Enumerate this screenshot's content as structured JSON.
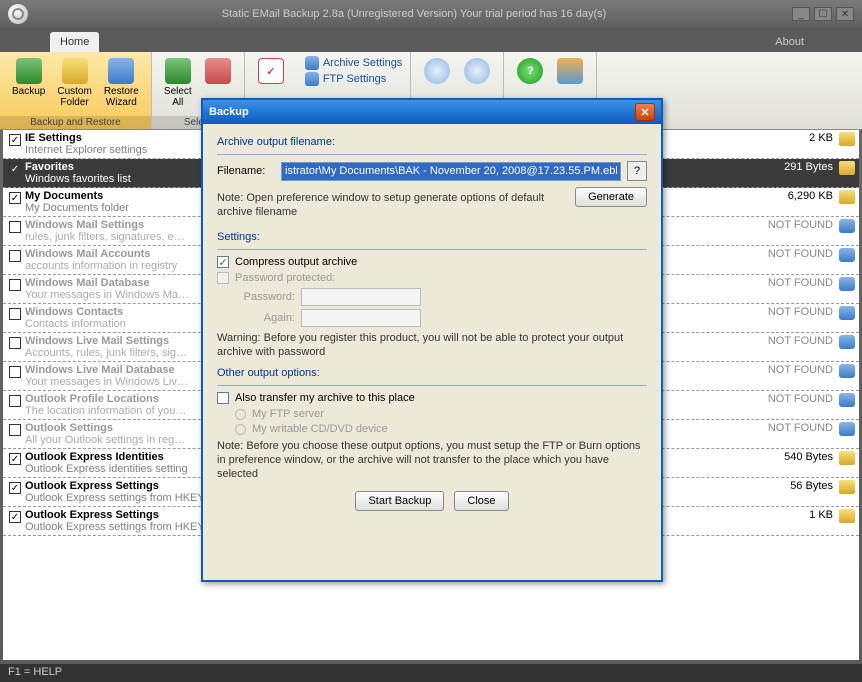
{
  "title": "Static EMail Backup 2.8a (Unregistered Version) Your trial period has 16 day(s)",
  "tabs": {
    "home": "Home",
    "about": "About"
  },
  "ribbon": {
    "backup": "Backup",
    "custom": "Custom\nFolder",
    "restore": "Restore\nWizard",
    "group1": "Backup and Restore",
    "selectall": "Select\nAll",
    "group2": "Select",
    "archive": "Archive Settings",
    "ftp": "FTP Settings"
  },
  "items": [
    {
      "checked": true,
      "title": "IE Settings",
      "desc": "Internet Explorer settings",
      "size": "2 KB",
      "found": true
    },
    {
      "checked": true,
      "title": "Favorites",
      "desc": "Windows favorites list",
      "size": "291 Bytes",
      "found": true,
      "sel": true
    },
    {
      "checked": true,
      "title": "My Documents",
      "desc": "My Documents folder",
      "size": "6,290 KB",
      "found": true
    },
    {
      "checked": false,
      "title": "Windows Mail Settings",
      "desc": "rules, junk filters, signatures, e…",
      "size": "NOT FOUND",
      "found": false,
      "gray": true
    },
    {
      "checked": false,
      "title": "Windows Mail Accounts",
      "desc": "accounts information in registry",
      "size": "NOT FOUND",
      "found": false,
      "gray": true
    },
    {
      "checked": false,
      "title": "Windows Mail Database",
      "desc": "Your messages in Windows Ma…",
      "size": "NOT FOUND",
      "found": false,
      "gray": true
    },
    {
      "checked": false,
      "title": "Windows Contacts",
      "desc": "Contacts information",
      "size": "NOT FOUND",
      "found": false,
      "gray": true
    },
    {
      "checked": false,
      "title": "Windows Live Mail Settings",
      "desc": "Accounts, rules, junk filters, sig…",
      "size": "NOT FOUND",
      "found": false,
      "gray": true
    },
    {
      "checked": false,
      "title": "Windows Live Mail Database",
      "desc": "Your messages in Windows Liv…",
      "size": "NOT FOUND",
      "found": false,
      "gray": true
    },
    {
      "checked": false,
      "title": "Outlook Profile Locations",
      "desc": "The location information of you…",
      "size": "NOT FOUND",
      "found": false,
      "gray": true
    },
    {
      "checked": false,
      "title": "Outlook Settings",
      "desc": "All your Outlook settings in reg…",
      "size": "NOT FOUND",
      "found": false,
      "gray": true
    },
    {
      "checked": true,
      "title": "Outlook Express Identities",
      "desc": "Outlook Express identities setting",
      "size": "540 Bytes",
      "found": true
    },
    {
      "checked": true,
      "title": "Outlook Express Settings",
      "desc": "Outlook Express settings from HKEY_CURRENT_USER",
      "size": "56 Bytes",
      "found": true
    },
    {
      "checked": true,
      "title": "Outlook Express Settings",
      "desc": "Outlook Express settings from HKEY_LOCAL_MACHINE",
      "size": "1 KB",
      "found": true
    }
  ],
  "status": "F1 = HELP",
  "dialog": {
    "title": "Backup",
    "g1": "Archive output filename:",
    "filenameLbl": "Filename:",
    "filename": "istrator\\My Documents\\BAK - November 20, 2008@17.23.55.PM.ebk",
    "q": "?",
    "note1": "Note: Open preference window to setup generate options of default archive filename",
    "generate": "Generate",
    "g2": "Settings:",
    "compress": "Compress output archive",
    "pwprot": "Password protected:",
    "pwlbl": "Password:",
    "aglbl": "Again:",
    "warn": "Warning: Before you register this product, you will not be able to protect your output archive with password",
    "g3": "Other output options:",
    "transfer": "Also transfer my archive to this place",
    "ftp": "My FTP server",
    "cd": "My writable CD/DVD device",
    "note2": "Note: Before you choose these output options, you must setup the FTP or Burn options in preference window, or the archive will not transfer to the place which you have selected",
    "start": "Start Backup",
    "close": "Close"
  }
}
